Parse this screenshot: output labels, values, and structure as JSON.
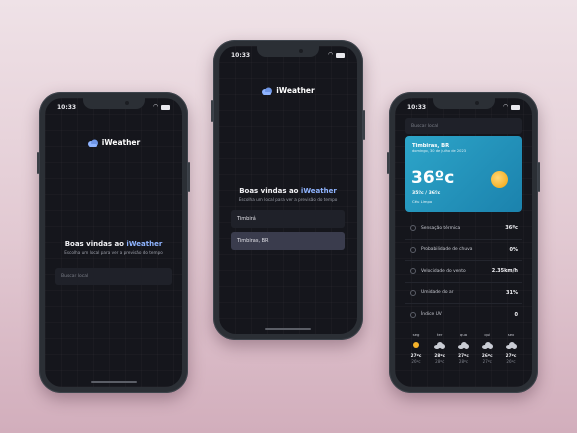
{
  "status": {
    "time": "10:33"
  },
  "brand": {
    "name": "iWeather"
  },
  "screens": {
    "welcome": {
      "title_prefix": "Boas vindas ao",
      "title_brand": "iWeather",
      "subtitle": "Escolha um local para ver a previsão do tempo",
      "search_placeholder": "Buscar local"
    },
    "search": {
      "title_prefix": "Boas vindas ao",
      "title_brand": "iWeather",
      "subtitle": "Escolha um local para ver a previsão do tempo",
      "search_value": "Timbirá",
      "suggestion": "Timbiras, BR"
    },
    "weather": {
      "search_placeholder": "Buscar local",
      "city": "Timbiras, BR",
      "date": "domingo, 30 de julho de 2023",
      "temperature": "36ºc",
      "range": "35ºc / 36ºc",
      "condition": "Céu Limpo",
      "details": [
        {
          "label": "Sensação térmica",
          "value": "36ºc",
          "icon": "thermometer-icon"
        },
        {
          "label": "Probabilidade de chuva",
          "value": "0%",
          "icon": "rain-icon"
        },
        {
          "label": "Velocidade do vento",
          "value": "2.35km/h",
          "icon": "wind-icon"
        },
        {
          "label": "Umidade do ar",
          "value": "31%",
          "icon": "drop-icon"
        },
        {
          "label": "Índice UV",
          "value": "0",
          "icon": "sun-icon"
        }
      ],
      "forecast": [
        {
          "day": "seg",
          "max": "27ºc",
          "min": "26ºc",
          "icon": "sun-icon"
        },
        {
          "day": "ter",
          "max": "28ºc",
          "min": "28ºc",
          "icon": "cloud-icon"
        },
        {
          "day": "qua",
          "max": "27ºc",
          "min": "28ºc",
          "icon": "cloud-icon"
        },
        {
          "day": "qui",
          "max": "26ºc",
          "min": "27ºc",
          "icon": "cloud-icon"
        },
        {
          "day": "sex",
          "max": "27ºc",
          "min": "26ºc",
          "icon": "cloud-icon"
        }
      ]
    }
  },
  "colors": {
    "background": "#e2c9d2",
    "screen": "#15161c",
    "accent": "#8fb4ff",
    "hero": "#2da5c9",
    "sun": "#f5b22a"
  }
}
